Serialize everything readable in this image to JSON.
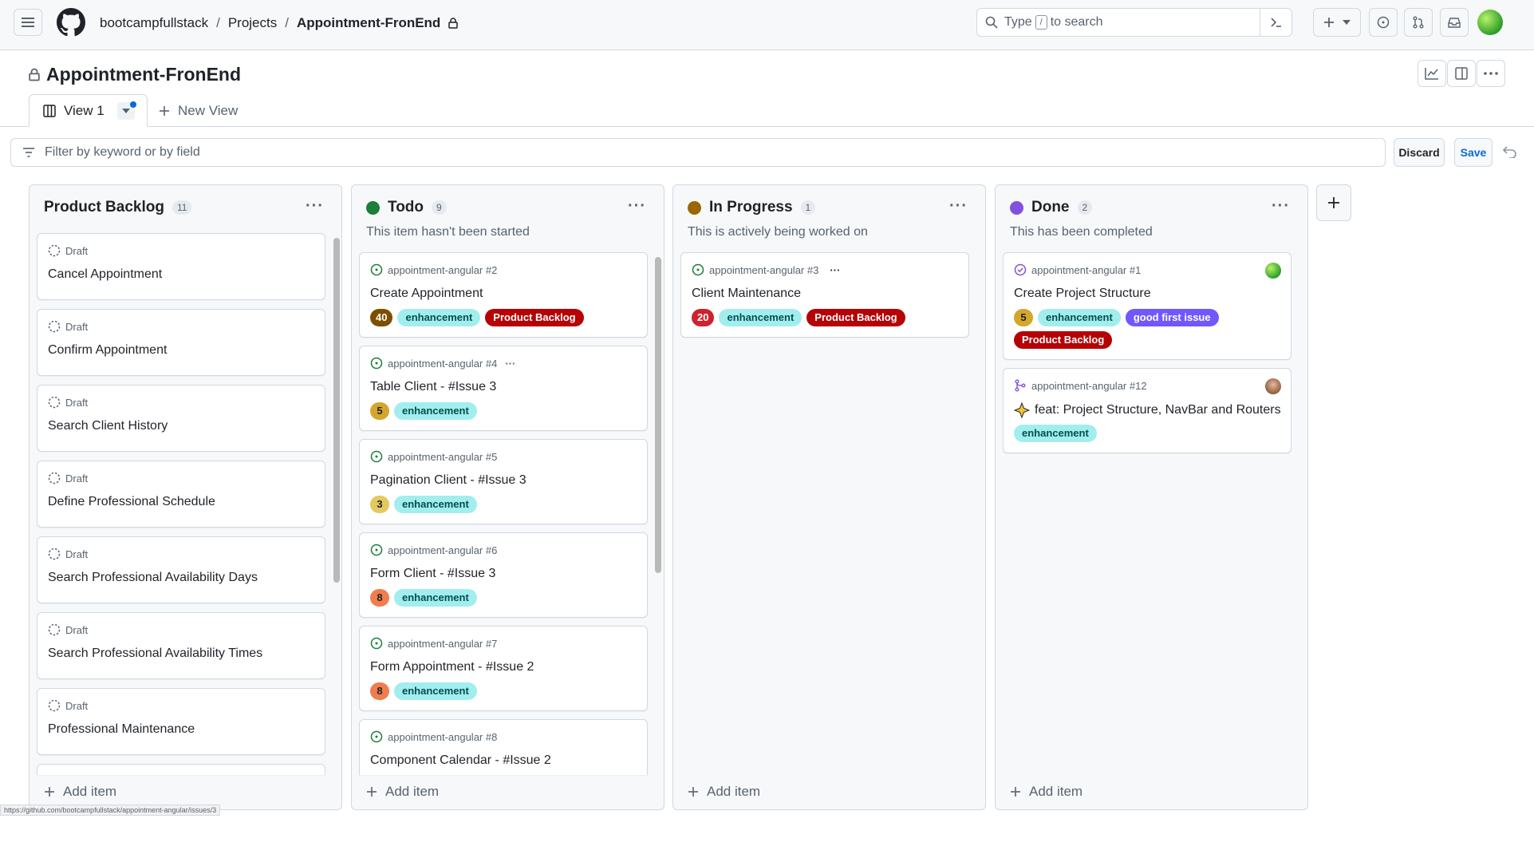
{
  "header": {
    "crumbs": [
      "bootcampfullstack",
      "Projects",
      "Appointment-FronEnd"
    ],
    "search_pre": "Type",
    "search_key": "/",
    "search_post": "to search"
  },
  "project": {
    "title": "Appointment-FronEnd",
    "view_tab": "View 1",
    "new_view": "New View"
  },
  "filter": {
    "placeholder": "Filter by keyword or by field",
    "discard": "Discard",
    "save": "Save"
  },
  "colors": {
    "todo": "#1a7f37",
    "in_progress": "#9a6700",
    "done": "#8250df",
    "enhancement": "#a2eeef",
    "product_backlog": "#b60205",
    "good_first_issue": "#7057ff"
  },
  "columns": {
    "backlog": {
      "name": "Product Backlog",
      "count": "11",
      "add": "Add item",
      "cards": [
        {
          "status": "Draft",
          "title": "Cancel Appointment"
        },
        {
          "status": "Draft",
          "title": "Confirm Appointment"
        },
        {
          "status": "Draft",
          "title": "Search Client History"
        },
        {
          "status": "Draft",
          "title": "Define Professional Schedule"
        },
        {
          "status": "Draft",
          "title": "Search Professional Availability Days"
        },
        {
          "status": "Draft",
          "title": "Search Professional Availability Times"
        },
        {
          "status": "Draft",
          "title": "Professional Maintenance"
        }
      ]
    },
    "todo": {
      "name": "Todo",
      "count": "9",
      "desc": "This item hasn't been started",
      "add": "Add item",
      "cards": [
        {
          "ref": "appointment-angular #2",
          "title": "Create Appointment",
          "estimate": "40",
          "estimate_color": "#7d4e00",
          "labels": [
            "enhancement",
            "Product Backlog"
          ]
        },
        {
          "ref": "appointment-angular #4",
          "title": "Table Client - #Issue 3",
          "estimate": "5",
          "estimate_color": "#d4a72c",
          "labels": [
            "enhancement"
          ]
        },
        {
          "ref": "appointment-angular #5",
          "title": "Pagination Client - #Issue 3",
          "estimate": "3",
          "estimate_color": "#e3c95e",
          "labels": [
            "enhancement"
          ]
        },
        {
          "ref": "appointment-angular #6",
          "title": "Form Client - #Issue 3",
          "estimate": "8",
          "estimate_color": "#f07d4d",
          "labels": [
            "enhancement"
          ]
        },
        {
          "ref": "appointment-angular #7",
          "title": "Form Appointment - #Issue 2",
          "estimate": "8",
          "estimate_color": "#f07d4d",
          "labels": [
            "enhancement"
          ]
        },
        {
          "ref": "appointment-angular #8",
          "title": "Component Calendar - #Issue 2"
        }
      ]
    },
    "in_progress": {
      "name": "In Progress",
      "count": "1",
      "desc": "This is actively being worked on",
      "add": "Add item",
      "cards": [
        {
          "ref": "appointment-angular #3",
          "title": "Client Maintenance",
          "estimate": "20",
          "estimate_color": "#cf222e",
          "labels": [
            "enhancement",
            "Product Backlog"
          ]
        }
      ]
    },
    "done": {
      "name": "Done",
      "count": "2",
      "desc": "This has been completed",
      "add": "Add item",
      "cards": [
        {
          "ref": "appointment-angular #1",
          "title": "Create Project Structure",
          "estimate": "5",
          "estimate_color": "#d4a72c",
          "labels": [
            "enhancement",
            "good first issue",
            "Product Backlog"
          ]
        },
        {
          "ref": "appointment-angular #12",
          "title": "feat: Project Structure, NavBar and Routers",
          "labels": [
            "enhancement"
          ]
        }
      ]
    }
  },
  "status_bar": {
    "url": "https://github.com/bootcampfullstack/appointment-angular/issues/3"
  }
}
